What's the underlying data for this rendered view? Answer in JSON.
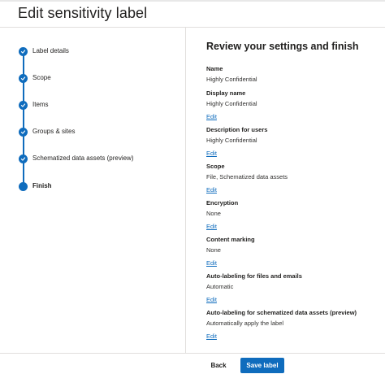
{
  "page": {
    "title": "Edit sensitivity label"
  },
  "stepper": {
    "steps": [
      {
        "label": "Label details",
        "state": "completed",
        "icon": "checkmark-icon"
      },
      {
        "label": "Scope",
        "state": "completed",
        "icon": "checkmark-icon"
      },
      {
        "label": "Items",
        "state": "completed",
        "icon": "checkmark-icon"
      },
      {
        "label": "Groups & sites",
        "state": "completed",
        "icon": "checkmark-icon"
      },
      {
        "label": "Schematized data assets (preview)",
        "state": "completed",
        "icon": "checkmark-icon"
      },
      {
        "label": "Finish",
        "state": "current",
        "icon": "filled-circle-icon"
      }
    ]
  },
  "main": {
    "heading": "Review your settings and finish",
    "sections": [
      {
        "label": "Name",
        "value": "Highly Confidential"
      },
      {
        "label": "Display name",
        "value": "Highly Confidential",
        "edit": "Edit"
      },
      {
        "label": "Description for users",
        "value": "Highly Confidential",
        "edit": "Edit"
      },
      {
        "label": "Scope",
        "value": "File, Schematized data assets",
        "edit": "Edit"
      },
      {
        "label": "Encryption",
        "value": "None",
        "edit": "Edit"
      },
      {
        "label": "Content marking",
        "value": "None",
        "edit": "Edit"
      },
      {
        "label": "Auto-labeling for files and emails",
        "value": "Automatic",
        "edit": "Edit"
      },
      {
        "label": "Auto-labeling for schematized data assets (preview)",
        "value": "Automatically apply the label",
        "edit": "Edit"
      }
    ]
  },
  "footer": {
    "back_label": "Back",
    "save_label": "Save label"
  },
  "colors": {
    "accent": "#0f6cbd",
    "text": "#201f1e",
    "divider": "#e1dfdd"
  }
}
